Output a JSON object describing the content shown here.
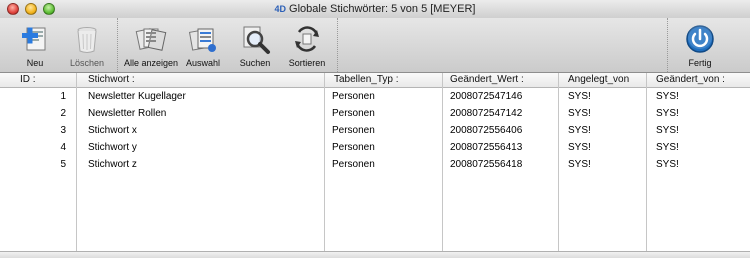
{
  "window": {
    "title": "Globale Stichwörter: 5 von 5      [MEYER]",
    "logo_text": "4D"
  },
  "toolbar": {
    "buttons": [
      {
        "label": "Neu",
        "icon": "new-record-icon",
        "enabled": true
      },
      {
        "label": "Löschen",
        "icon": "trash-icon",
        "enabled": false
      },
      {
        "label": "Alle anzeigen",
        "icon": "show-all-icon",
        "enabled": true
      },
      {
        "label": "Auswahl",
        "icon": "subset-icon",
        "enabled": true
      },
      {
        "label": "Suchen",
        "icon": "magnifier-icon",
        "enabled": true
      },
      {
        "label": "Sortieren",
        "icon": "sort-icon",
        "enabled": true
      },
      {
        "label": "Fertig",
        "icon": "power-icon",
        "enabled": true
      }
    ]
  },
  "table": {
    "columns": [
      "ID :",
      "Stichwort :",
      "Tabellen_Typ :",
      "Geändert_Wert :",
      "Angelegt_von",
      "Geändert_von :"
    ],
    "rows": [
      {
        "id": "1",
        "stichwort": "Newsletter Kugellager",
        "typ": "Personen",
        "wert": "2008072547146",
        "angelegt": "SYS!",
        "geaendert": "SYS!"
      },
      {
        "id": "2",
        "stichwort": "Newsletter Rollen",
        "typ": "Personen",
        "wert": "2008072547142",
        "angelegt": "SYS!",
        "geaendert": "SYS!"
      },
      {
        "id": "3",
        "stichwort": "Stichwort x",
        "typ": "Personen",
        "wert": "2008072556406",
        "angelegt": "SYS!",
        "geaendert": "SYS!"
      },
      {
        "id": "4",
        "stichwort": "Stichwort y",
        "typ": "Personen",
        "wert": "2008072556413",
        "angelegt": "SYS!",
        "geaendert": "SYS!"
      },
      {
        "id": "5",
        "stichwort": "Stichwort z",
        "typ": "Personen",
        "wert": "2008072556418",
        "angelegt": "SYS!",
        "geaendert": "SYS!"
      }
    ]
  },
  "colors": {
    "power_button": "#1f6fc0",
    "header_bg": "#eeeeee"
  }
}
